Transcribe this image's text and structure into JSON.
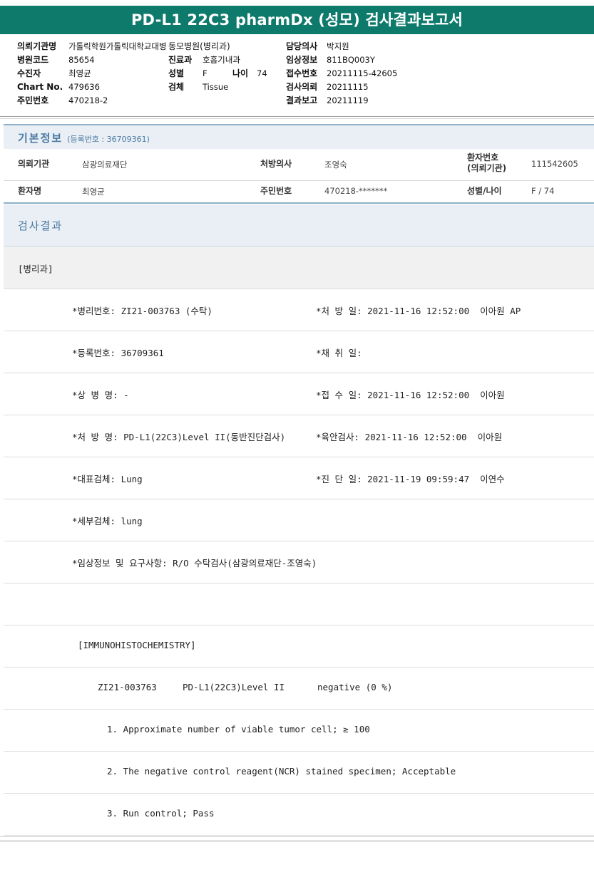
{
  "title": "PD-L1 22C3 pharmDx (성모) 검사결과보고서",
  "header": {
    "col1": [
      {
        "key": "의뢰기관명",
        "value": "가톨릭학원가톨릭대학교대병"
      },
      {
        "key": "병원코드",
        "value": "85654"
      },
      {
        "key": "수진자",
        "value": "최영균"
      },
      {
        "key": "Chart No.",
        "value": "479636"
      },
      {
        "key": "주민번호",
        "value": "470218-2"
      }
    ],
    "col2": [
      {
        "key": "동모병원(병리과)",
        "value": ""
      },
      {
        "key": "진료과",
        "value": "호흡기내과"
      },
      {
        "key": "성별",
        "value": "F"
      },
      {
        "key": "검체",
        "value": "Tissue"
      }
    ],
    "age_key": "나이",
    "age_value": "74",
    "col3": [
      {
        "key": "담당의사",
        "value": "박지원"
      },
      {
        "key": "임상정보",
        "value": "811BQ003Y"
      },
      {
        "key": "접수번호",
        "value": "20211115-42605"
      },
      {
        "key": "검사의뢰",
        "value": "20211115"
      },
      {
        "key": "결과보고",
        "value": "20211119"
      }
    ]
  },
  "basic": {
    "title": "기본정보",
    "subtitle": "(등록번호 : 36709361)",
    "row1": {
      "label1": "의뢰기관",
      "value1": "삼광의료재단",
      "label2": "처방의사",
      "value2": "조영숙",
      "label3a": "환자번호",
      "label3b": "(의뢰기관)",
      "value3": "111542605"
    },
    "row2": {
      "label1": "환자명",
      "value1": "최영균",
      "label2": "주민번호",
      "value2": "470218-*******",
      "label3": "성별/나이",
      "value3": "F / 74"
    }
  },
  "result": {
    "title": "검사결과",
    "dept": "[병리과]",
    "lines": [
      {
        "left": "*병리번호: ZI21-003763 (수탁)",
        "right": "*처 방 일: 2021-11-16 12:52:00  이아원 AP"
      },
      {
        "left": "*등록번호: 36709361",
        "right": "*채 취 일:"
      },
      {
        "left": "*상 병 명: -",
        "right": "*접 수 일: 2021-11-16 12:52:00  이아원"
      },
      {
        "left": "*처 방 명: PD-L1(22C3)Level II(동반진단검사)",
        "right": "*육안검사: 2021-11-16 12:52:00  이아원"
      },
      {
        "left": "*대표검체: Lung",
        "right": "*진 단 일: 2021-11-19 09:59:47  이연수"
      },
      {
        "left": "*세부검체: lung",
        "right": ""
      },
      {
        "left": "*임상정보 및 요구사항: R/O 수탁검사(삼광의료재단-조영숙)",
        "right": ""
      },
      {
        "left": "",
        "right": ""
      },
      {
        "left": "[IMMUNOHISTOCHEMISTRY]",
        "right": ""
      }
    ],
    "ihc": {
      "code": "ZI21-003763",
      "test": "PD-L1(22C3)Level II",
      "result": "negative (0 %)"
    },
    "notes": [
      "1. Approximate number of viable tumor cell; ≥ 100",
      "2. The negative control reagent(NCR) stained specimen; Acceptable",
      "3. Run control; Pass"
    ]
  }
}
